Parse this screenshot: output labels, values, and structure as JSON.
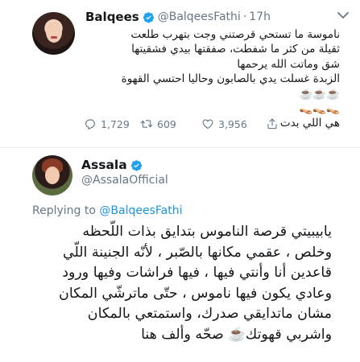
{
  "tweet1": {
    "name": "Balqees",
    "handle": "@BalqeesFathi",
    "separator": "·",
    "time": "17h",
    "lines": [
      "ناموسة ما تستحي قرصتني وجت بتهرب طلعت",
      "ثقيلة من كثر ما شفطت، صفقتها بيدي فشقيتها",
      "شق وماتت الله يرحمها",
      "الزبدة غسلت يدي بالصابون وحاليا احتسي القهوة",
      "☕️☕️☕️",
      "👡👡👡",
      "هي اللي بدت"
    ],
    "actions": {
      "replies": "1,729",
      "retweets": "609",
      "likes": "3,956"
    }
  },
  "tweet2": {
    "name": "Assala",
    "handle": "@AssalaOfficial",
    "replying_prefix": "Replying to",
    "replying_to": "@BalqeesFathi",
    "lines": [
      "يابيبيتي قرصة الناموس بتدايق بذات اللّحظه",
      "وخلص ، عقمي مكانها بالصّبر ، لأنّه الجنينة اللّي",
      "قاعدين أنا وأنتي فيها ، فيها فراشات وفيها ورود",
      "وعادي يكون فيها ناموس ، حتّى ماترشّي المكان",
      "مشان ماتدايقي صدرك، واستمتعي بالمكان",
      "واشربي قهوتك☕️ صحّه وألف هنا"
    ]
  },
  "colors": {
    "verified": "#1da1f2",
    "mention": "#1b95e0",
    "secondary_text": "#657786",
    "primary_text": "#14171a"
  },
  "icons": [
    "verified-badge-icon",
    "chevron-down-icon",
    "reply-icon",
    "retweet-icon",
    "like-icon",
    "share-icon"
  ]
}
